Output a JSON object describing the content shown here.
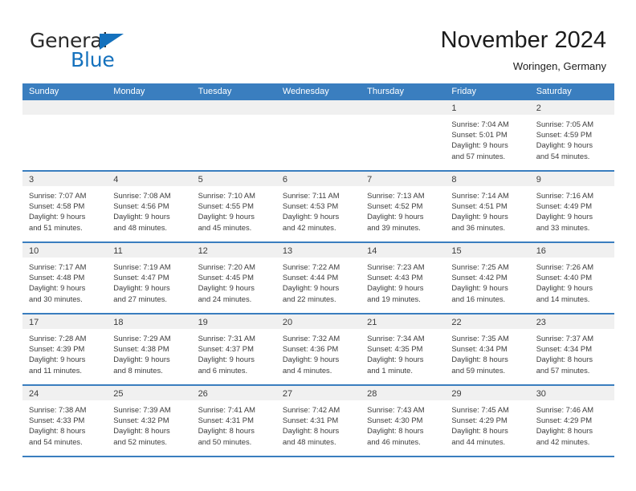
{
  "brand": {
    "name_part1": "General",
    "name_part2": "Blue",
    "colors": {
      "blue": "#1471bd",
      "dark": "#2b2b2b"
    }
  },
  "header": {
    "month_title": "November 2024",
    "location": "Woringen, Germany"
  },
  "theme": {
    "header_blue": "#3a7ebf",
    "day_band_gray": "#f0f0f0",
    "text": "#3c3c3c"
  },
  "calendar": {
    "weekdays": [
      "Sunday",
      "Monday",
      "Tuesday",
      "Wednesday",
      "Thursday",
      "Friday",
      "Saturday"
    ],
    "weeks": [
      [
        {
          "day": "",
          "lines": []
        },
        {
          "day": "",
          "lines": []
        },
        {
          "day": "",
          "lines": []
        },
        {
          "day": "",
          "lines": []
        },
        {
          "day": "",
          "lines": []
        },
        {
          "day": "1",
          "lines": [
            "Sunrise: 7:04 AM",
            "Sunset: 5:01 PM",
            "Daylight: 9 hours",
            "and 57 minutes."
          ]
        },
        {
          "day": "2",
          "lines": [
            "Sunrise: 7:05 AM",
            "Sunset: 4:59 PM",
            "Daylight: 9 hours",
            "and 54 minutes."
          ]
        }
      ],
      [
        {
          "day": "3",
          "lines": [
            "Sunrise: 7:07 AM",
            "Sunset: 4:58 PM",
            "Daylight: 9 hours",
            "and 51 minutes."
          ]
        },
        {
          "day": "4",
          "lines": [
            "Sunrise: 7:08 AM",
            "Sunset: 4:56 PM",
            "Daylight: 9 hours",
            "and 48 minutes."
          ]
        },
        {
          "day": "5",
          "lines": [
            "Sunrise: 7:10 AM",
            "Sunset: 4:55 PM",
            "Daylight: 9 hours",
            "and 45 minutes."
          ]
        },
        {
          "day": "6",
          "lines": [
            "Sunrise: 7:11 AM",
            "Sunset: 4:53 PM",
            "Daylight: 9 hours",
            "and 42 minutes."
          ]
        },
        {
          "day": "7",
          "lines": [
            "Sunrise: 7:13 AM",
            "Sunset: 4:52 PM",
            "Daylight: 9 hours",
            "and 39 minutes."
          ]
        },
        {
          "day": "8",
          "lines": [
            "Sunrise: 7:14 AM",
            "Sunset: 4:51 PM",
            "Daylight: 9 hours",
            "and 36 minutes."
          ]
        },
        {
          "day": "9",
          "lines": [
            "Sunrise: 7:16 AM",
            "Sunset: 4:49 PM",
            "Daylight: 9 hours",
            "and 33 minutes."
          ]
        }
      ],
      [
        {
          "day": "10",
          "lines": [
            "Sunrise: 7:17 AM",
            "Sunset: 4:48 PM",
            "Daylight: 9 hours",
            "and 30 minutes."
          ]
        },
        {
          "day": "11",
          "lines": [
            "Sunrise: 7:19 AM",
            "Sunset: 4:47 PM",
            "Daylight: 9 hours",
            "and 27 minutes."
          ]
        },
        {
          "day": "12",
          "lines": [
            "Sunrise: 7:20 AM",
            "Sunset: 4:45 PM",
            "Daylight: 9 hours",
            "and 24 minutes."
          ]
        },
        {
          "day": "13",
          "lines": [
            "Sunrise: 7:22 AM",
            "Sunset: 4:44 PM",
            "Daylight: 9 hours",
            "and 22 minutes."
          ]
        },
        {
          "day": "14",
          "lines": [
            "Sunrise: 7:23 AM",
            "Sunset: 4:43 PM",
            "Daylight: 9 hours",
            "and 19 minutes."
          ]
        },
        {
          "day": "15",
          "lines": [
            "Sunrise: 7:25 AM",
            "Sunset: 4:42 PM",
            "Daylight: 9 hours",
            "and 16 minutes."
          ]
        },
        {
          "day": "16",
          "lines": [
            "Sunrise: 7:26 AM",
            "Sunset: 4:40 PM",
            "Daylight: 9 hours",
            "and 14 minutes."
          ]
        }
      ],
      [
        {
          "day": "17",
          "lines": [
            "Sunrise: 7:28 AM",
            "Sunset: 4:39 PM",
            "Daylight: 9 hours",
            "and 11 minutes."
          ]
        },
        {
          "day": "18",
          "lines": [
            "Sunrise: 7:29 AM",
            "Sunset: 4:38 PM",
            "Daylight: 9 hours",
            "and 8 minutes."
          ]
        },
        {
          "day": "19",
          "lines": [
            "Sunrise: 7:31 AM",
            "Sunset: 4:37 PM",
            "Daylight: 9 hours",
            "and 6 minutes."
          ]
        },
        {
          "day": "20",
          "lines": [
            "Sunrise: 7:32 AM",
            "Sunset: 4:36 PM",
            "Daylight: 9 hours",
            "and 4 minutes."
          ]
        },
        {
          "day": "21",
          "lines": [
            "Sunrise: 7:34 AM",
            "Sunset: 4:35 PM",
            "Daylight: 9 hours",
            "and 1 minute."
          ]
        },
        {
          "day": "22",
          "lines": [
            "Sunrise: 7:35 AM",
            "Sunset: 4:34 PM",
            "Daylight: 8 hours",
            "and 59 minutes."
          ]
        },
        {
          "day": "23",
          "lines": [
            "Sunrise: 7:37 AM",
            "Sunset: 4:34 PM",
            "Daylight: 8 hours",
            "and 57 minutes."
          ]
        }
      ],
      [
        {
          "day": "24",
          "lines": [
            "Sunrise: 7:38 AM",
            "Sunset: 4:33 PM",
            "Daylight: 8 hours",
            "and 54 minutes."
          ]
        },
        {
          "day": "25",
          "lines": [
            "Sunrise: 7:39 AM",
            "Sunset: 4:32 PM",
            "Daylight: 8 hours",
            "and 52 minutes."
          ]
        },
        {
          "day": "26",
          "lines": [
            "Sunrise: 7:41 AM",
            "Sunset: 4:31 PM",
            "Daylight: 8 hours",
            "and 50 minutes."
          ]
        },
        {
          "day": "27",
          "lines": [
            "Sunrise: 7:42 AM",
            "Sunset: 4:31 PM",
            "Daylight: 8 hours",
            "and 48 minutes."
          ]
        },
        {
          "day": "28",
          "lines": [
            "Sunrise: 7:43 AM",
            "Sunset: 4:30 PM",
            "Daylight: 8 hours",
            "and 46 minutes."
          ]
        },
        {
          "day": "29",
          "lines": [
            "Sunrise: 7:45 AM",
            "Sunset: 4:29 PM",
            "Daylight: 8 hours",
            "and 44 minutes."
          ]
        },
        {
          "day": "30",
          "lines": [
            "Sunrise: 7:46 AM",
            "Sunset: 4:29 PM",
            "Daylight: 8 hours",
            "and 42 minutes."
          ]
        }
      ]
    ]
  }
}
